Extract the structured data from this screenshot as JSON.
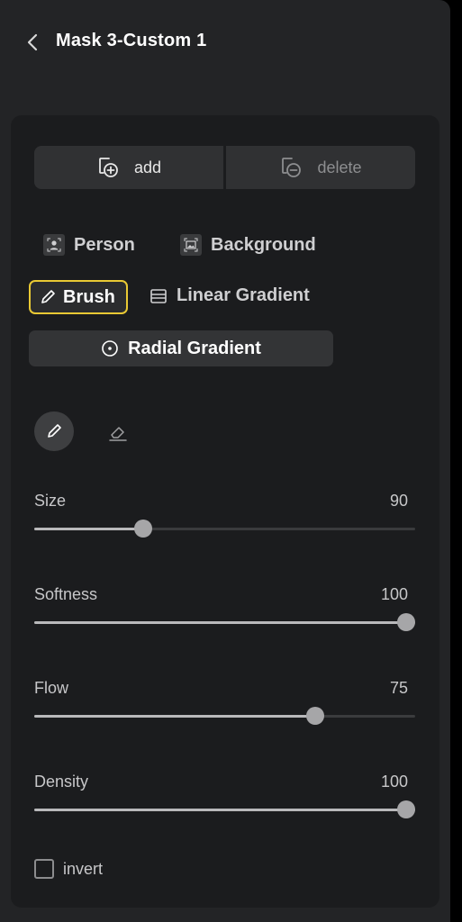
{
  "header": {
    "title": "Mask 3-Custom 1"
  },
  "actions": {
    "add_label": "add",
    "delete_label": "delete"
  },
  "mask_types": {
    "person": "Person",
    "background": "Background",
    "brush": "Brush",
    "linear_gradient": "Linear Gradient",
    "radial_gradient": "Radial Gradient",
    "selected": "Brush"
  },
  "tools": [
    "pen-icon",
    "eraser-icon"
  ],
  "sliders": [
    {
      "id": "size",
      "label": "Size",
      "value": "90",
      "fraction": 0.285
    },
    {
      "id": "softness",
      "label": "Softness",
      "value": "100",
      "fraction": 1.0
    },
    {
      "id": "flow",
      "label": "Flow",
      "value": "75",
      "fraction": 0.738
    },
    {
      "id": "density",
      "label": "Density",
      "value": "100",
      "fraction": 1.0
    }
  ],
  "invert": {
    "label": "invert",
    "checked": false
  },
  "colors": {
    "accent": "#e9c934",
    "panel": "#232426",
    "card": "#1b1c1e"
  }
}
